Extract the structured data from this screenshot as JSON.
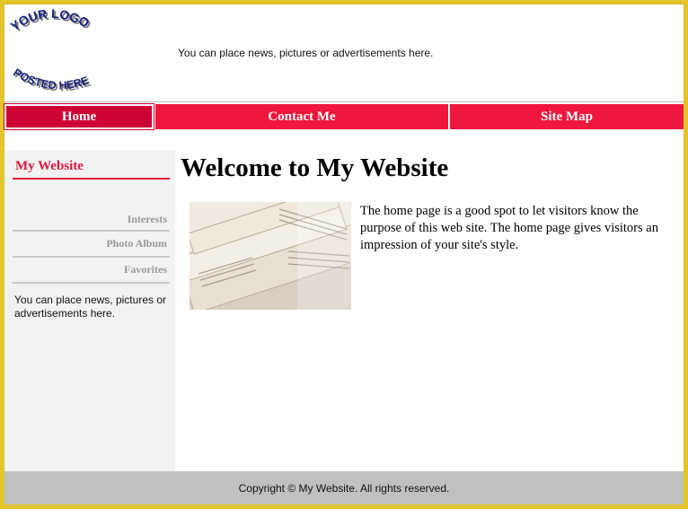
{
  "header": {
    "logo_top_text": "YOUR LOGO",
    "logo_bottom_text": "POSTED HERE",
    "news_text": "You can place news, pictures or advertisements here."
  },
  "nav": {
    "items": [
      {
        "label": "Home",
        "active": true
      },
      {
        "label": "Contact Me",
        "active": false
      },
      {
        "label": "Site Map",
        "active": false
      }
    ]
  },
  "sidebar": {
    "title": "My Website",
    "links": [
      "Interests",
      "Photo Album",
      "Favorites"
    ],
    "news_text": "You can place news, pictures or advertisements here."
  },
  "main": {
    "title": "Welcome to My Website",
    "body": "The home page is a good spot to let visitors know the purpose of this web site. The home page gives visitors an impression of your site's style."
  },
  "footer": {
    "copyright": "Copyright © My Website. All rights reserved."
  },
  "colors": {
    "frame": "#e3c42a",
    "nav": "#f0173c",
    "nav_active": "#cc0033",
    "accent": "#e0183c",
    "logo": "#1a237e",
    "footer": "#c0c0c0"
  },
  "icons": {
    "logo": "curved-logo-text",
    "photo": "newspaper-stack-image"
  }
}
